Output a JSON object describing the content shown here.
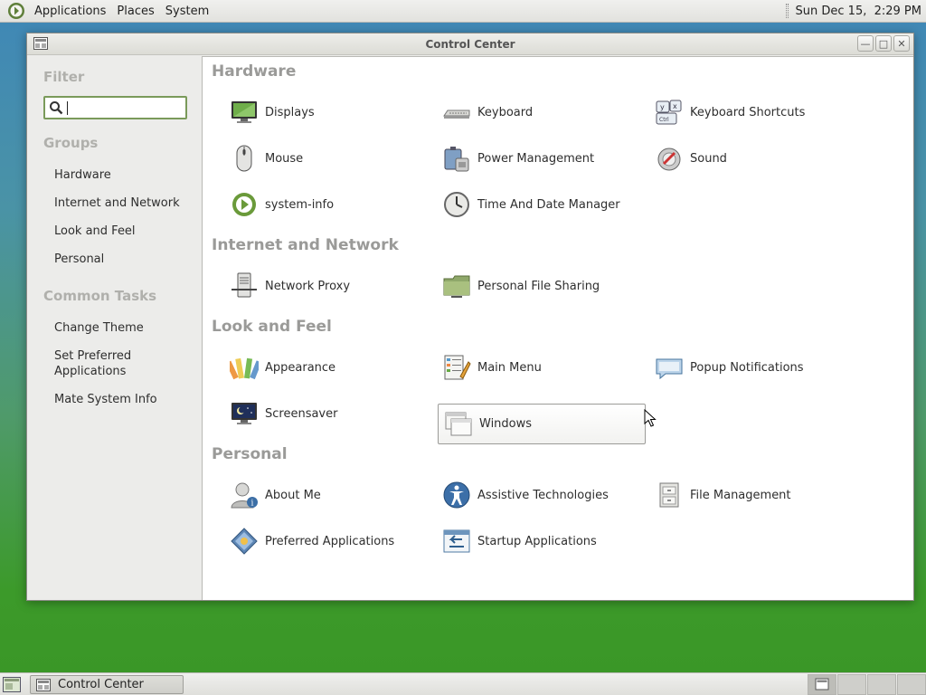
{
  "top_panel": {
    "menus": [
      "Applications",
      "Places",
      "System"
    ],
    "clock": "Sun Dec 15,  2:29 PM"
  },
  "window": {
    "title": "Control Center"
  },
  "sidebar": {
    "filter_heading": "Filter",
    "search_value": "",
    "groups_heading": "Groups",
    "groups": [
      "Hardware",
      "Internet and Network",
      "Look and Feel",
      "Personal"
    ],
    "tasks_heading": "Common Tasks",
    "tasks": [
      "Change Theme",
      "Set Preferred\nApplications",
      "Mate System Info"
    ]
  },
  "content": {
    "groups": [
      {
        "title": "Hardware",
        "items": [
          {
            "label": "Displays",
            "icon": "display-icon"
          },
          {
            "label": "Keyboard",
            "icon": "keyboard-icon"
          },
          {
            "label": "Keyboard Shortcuts",
            "icon": "keyboard-shortcuts-icon"
          },
          {
            "label": "Mouse",
            "icon": "mouse-icon"
          },
          {
            "label": "Power Management",
            "icon": "power-icon"
          },
          {
            "label": "Sound",
            "icon": "sound-icon"
          },
          {
            "label": "system-info",
            "icon": "system-info-icon"
          },
          {
            "label": "Time And Date Manager",
            "icon": "clock-icon"
          }
        ]
      },
      {
        "title": "Internet and Network",
        "items": [
          {
            "label": "Network Proxy",
            "icon": "network-proxy-icon"
          },
          {
            "label": "Personal File Sharing",
            "icon": "folder-share-icon"
          }
        ]
      },
      {
        "title": "Look and Feel",
        "items": [
          {
            "label": "Appearance",
            "icon": "appearance-icon"
          },
          {
            "label": "Main Menu",
            "icon": "main-menu-icon"
          },
          {
            "label": "Popup Notifications",
            "icon": "notification-icon"
          },
          {
            "label": "Screensaver",
            "icon": "screensaver-icon"
          },
          {
            "label": "Windows",
            "icon": "windows-icon",
            "selected": true
          }
        ]
      },
      {
        "title": "Personal",
        "items": [
          {
            "label": "About Me",
            "icon": "about-me-icon"
          },
          {
            "label": "Assistive Technologies",
            "icon": "accessibility-icon"
          },
          {
            "label": "File Management",
            "icon": "file-management-icon"
          },
          {
            "label": "Preferred Applications",
            "icon": "preferred-apps-icon"
          },
          {
            "label": "Startup Applications",
            "icon": "startup-icon"
          }
        ]
      }
    ]
  },
  "bottom_panel": {
    "task_label": "Control Center"
  },
  "colors": {
    "accent": "#7a9a5a",
    "heading_gray": "#9a9a98"
  }
}
